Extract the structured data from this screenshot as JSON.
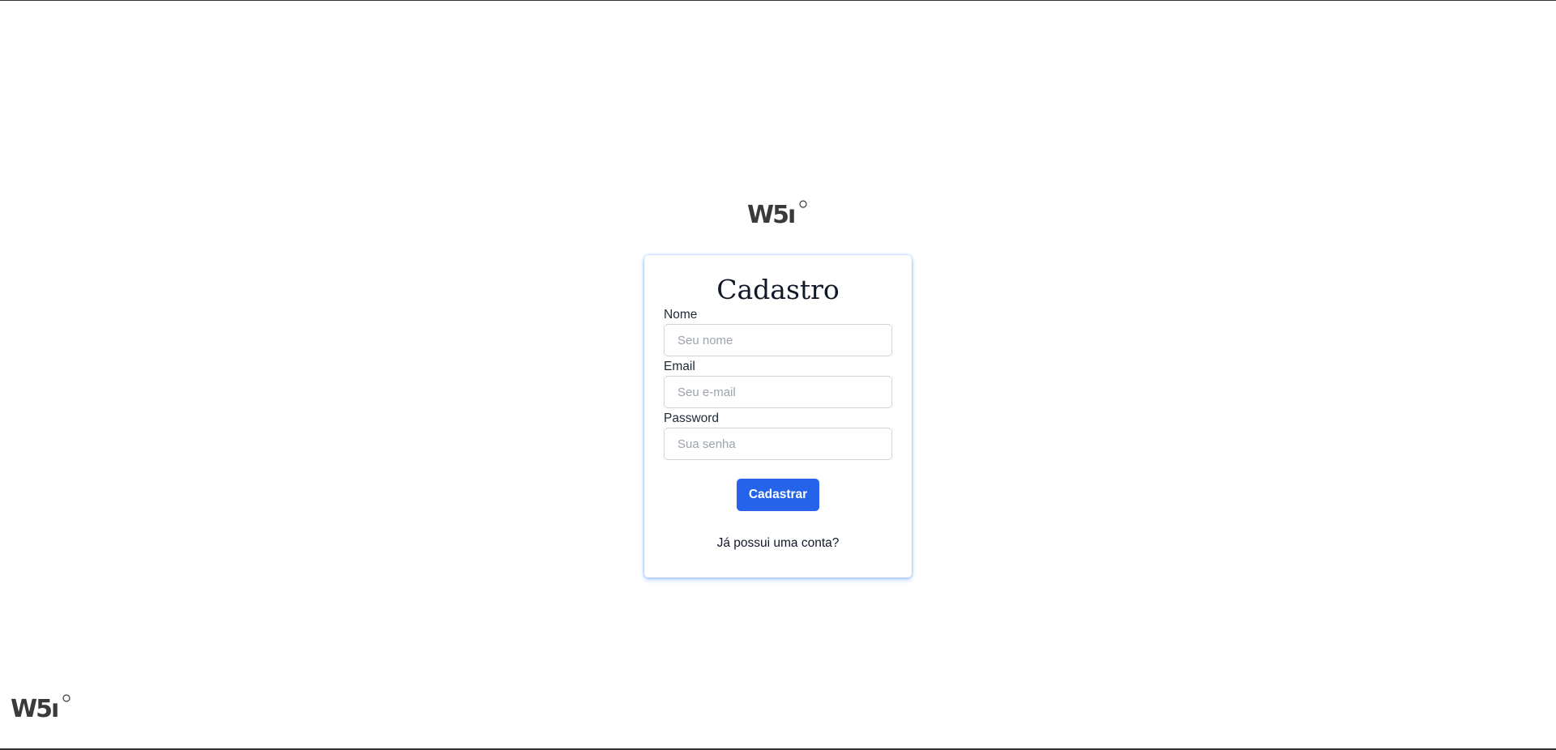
{
  "brand": {
    "logo_text": "W5i"
  },
  "form": {
    "title": "Cadastro",
    "fields": [
      {
        "label": "Nome",
        "placeholder": "Seu nome",
        "value": ""
      },
      {
        "label": "Email",
        "placeholder": "Seu e-mail",
        "value": ""
      },
      {
        "label": "Password",
        "placeholder": "Sua senha",
        "value": ""
      }
    ],
    "submit_label": "Cadastrar",
    "login_link": "Já possui uma conta?"
  },
  "colors": {
    "primary": "#2563eb",
    "logo": "#3a3a3a",
    "card_glow": "#3b82f6"
  }
}
